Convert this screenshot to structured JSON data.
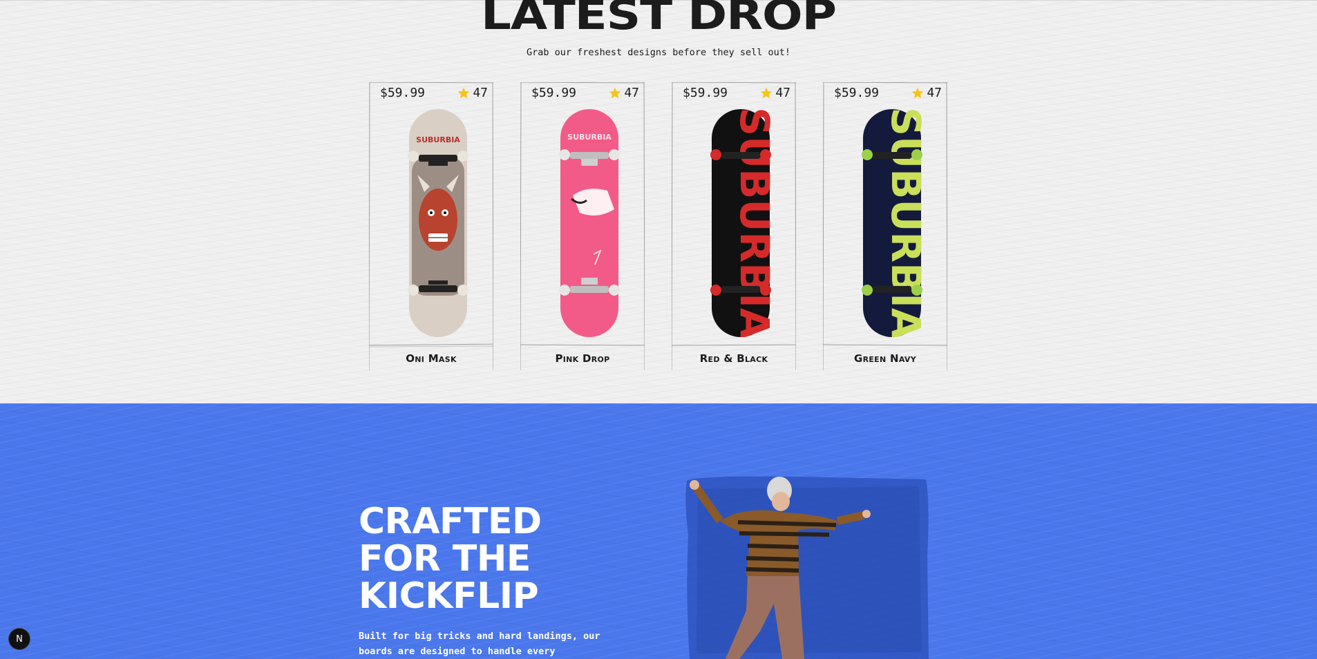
{
  "latest": {
    "title": "LATEST DROP",
    "subtitle": "Grab our freshest designs before they sell out!"
  },
  "products": [
    {
      "price": "$59.99",
      "rating": "47",
      "name": "Oni Mask"
    },
    {
      "price": "$59.99",
      "rating": "47",
      "name": "Pink Drop"
    },
    {
      "price": "$59.99",
      "rating": "47",
      "name": "Red & Black"
    },
    {
      "price": "$59.99",
      "rating": "47",
      "name": "Green Navy"
    }
  ],
  "board_brand": "SUBURBIA",
  "feature": {
    "headline_lines": [
      "CRAFTED",
      "FOR THE",
      "KICKFLIP"
    ],
    "body": "Built for big tricks and hard landings, our boards are designed to handle every"
  },
  "next_badge": "N",
  "colors": {
    "page_bg": "#efefef",
    "feature_bg": "#4a77ec",
    "star": "#f5c518",
    "board_cream": "#d9cfc4",
    "board_pink": "#f25b88",
    "board_black": "#111111",
    "board_navy": "#141a3c",
    "wheel_lime": "#9bd14a",
    "wheel_red": "#d62a2a"
  }
}
